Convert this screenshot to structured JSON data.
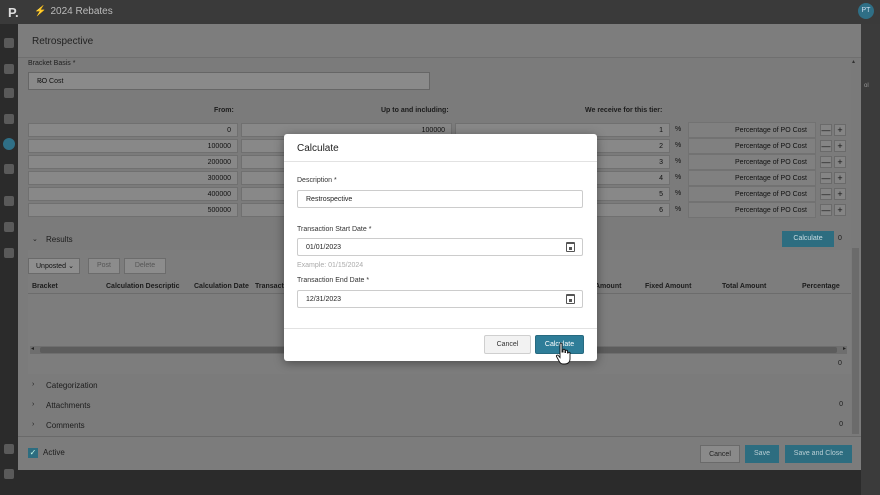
{
  "app": {
    "logo": "P.",
    "title": "2024 Rebates",
    "user_initials": "PT",
    "background_hint": "ol"
  },
  "panel": {
    "title": "Retrospective",
    "bracket_basis_label": "Bracket Basis *",
    "bracket_basis_value": "PO Cost",
    "tier_headers": {
      "from": "From:",
      "up_to": "Up to and including:",
      "receive": "We receive for this tier:"
    },
    "tiers": [
      {
        "from": "0",
        "to": "100000",
        "pct": "1",
        "unit": "%",
        "basis": "Percentage of PO Cost"
      },
      {
        "from": "100000",
        "to": "",
        "pct": "2",
        "unit": "%",
        "basis": "Percentage of PO Cost"
      },
      {
        "from": "200000",
        "to": "",
        "pct": "3",
        "unit": "%",
        "basis": "Percentage of PO Cost"
      },
      {
        "from": "300000",
        "to": "",
        "pct": "4",
        "unit": "%",
        "basis": "Percentage of PO Cost"
      },
      {
        "from": "400000",
        "to": "",
        "pct": "5",
        "unit": "%",
        "basis": "Percentage of PO Cost"
      },
      {
        "from": "500000",
        "to": "",
        "pct": "6",
        "unit": "%",
        "basis": "Percentage of PO Cost"
      }
    ],
    "minus": "—",
    "plus": "+",
    "results": {
      "title": "Results",
      "calculate_label": "Calculate",
      "count": "0",
      "filter_value": "Unposted",
      "post_label": "Post",
      "delete_label": "Delete",
      "columns": [
        "Bracket",
        "Calculation Descriptic",
        "Calculation Date",
        "Transact",
        "Amount",
        "Fixed Amount",
        "Total Amount",
        "Percentage"
      ],
      "row_count": "0"
    },
    "sections": [
      {
        "title": "Categorization",
        "count": ""
      },
      {
        "title": "Attachments",
        "count": "0"
      },
      {
        "title": "Comments",
        "count": "0"
      }
    ],
    "footer": {
      "active_label": "Active",
      "cancel_label": "Cancel",
      "save_label": "Save",
      "save_close_label": "Save and Close"
    }
  },
  "modal": {
    "title": "Calculate",
    "description_label": "Description *",
    "description_value": "Restrospective",
    "start_label": "Transaction Start Date *",
    "start_value": "01/01/2023",
    "start_hint": "Example: 01/15/2024",
    "end_label": "Transaction End Date *",
    "end_value": "12/31/2023",
    "cancel_label": "Cancel",
    "calculate_label": "Calculate"
  },
  "colors": {
    "accent": "#2e7d98",
    "overlay": "#7b7b7b"
  }
}
